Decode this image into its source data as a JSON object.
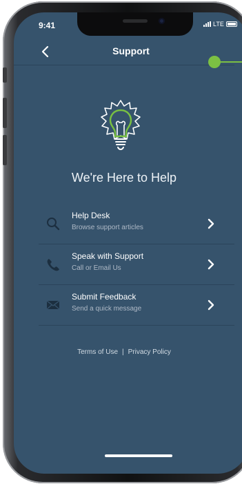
{
  "status": {
    "time": "9:41",
    "network": "LTE"
  },
  "header": {
    "title": "Support"
  },
  "hero": {
    "text": "We're Here to Help"
  },
  "items": [
    {
      "title": "Help Desk",
      "subtitle": "Browse support articles",
      "icon": "search-icon"
    },
    {
      "title": "Speak with Support",
      "subtitle": "Call or Email Us",
      "icon": "phone-icon"
    },
    {
      "title": "Submit Feedback",
      "subtitle": "Send a quick message",
      "icon": "envelope-icon"
    }
  ],
  "footer": {
    "terms": "Terms of Use",
    "separator": "|",
    "privacy": "Privacy Policy"
  },
  "colors": {
    "screen_bg": "#36536c",
    "accent_green": "#79c142",
    "marker_green": "#7cc043"
  }
}
